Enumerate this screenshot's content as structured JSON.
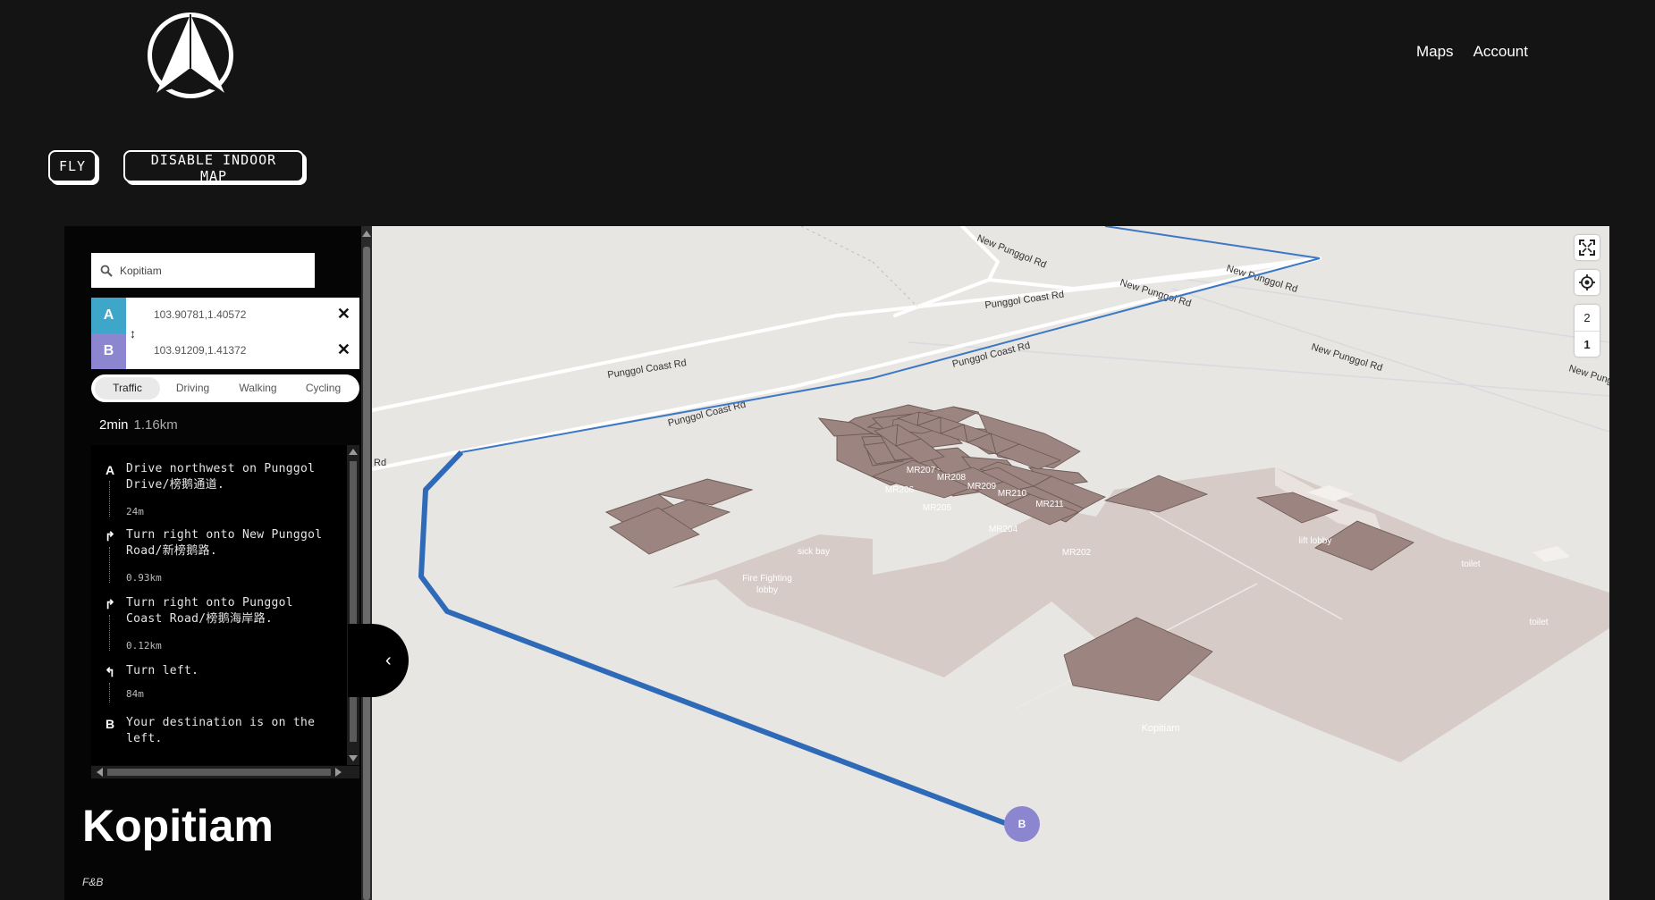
{
  "header": {
    "nav": [
      {
        "label": "Maps"
      },
      {
        "label": "Account"
      }
    ]
  },
  "toolbar": {
    "fly_label": "FLY",
    "indoor_label": "DISABLE INDOOR MAP"
  },
  "search": {
    "value": "Kopitiam"
  },
  "waypoints": {
    "a": {
      "badge": "A",
      "coords": "103.90781,1.40572"
    },
    "b": {
      "badge": "B",
      "coords": "103.91209,1.41372"
    },
    "remove": "✕",
    "swap": "↕"
  },
  "modes": [
    {
      "label": "Traffic",
      "active": true
    },
    {
      "label": "Driving",
      "active": false
    },
    {
      "label": "Walking",
      "active": false
    },
    {
      "label": "Cycling",
      "active": false
    }
  ],
  "route": {
    "duration": "2min",
    "distance": "1.16km"
  },
  "steps": [
    {
      "icon": "A",
      "text": "Drive northwest on Punggol Drive/榜鹅通道.",
      "length": "24m"
    },
    {
      "icon": "↱",
      "text": "Turn right onto New Punggol Road/新榜鹅路.",
      "length": "0.93km"
    },
    {
      "icon": "↱",
      "text": "Turn right onto Punggol Coast Road/榜鹅海岸路.",
      "length": "0.12km"
    },
    {
      "icon": "↰",
      "text": "Turn left.",
      "length": "84m"
    },
    {
      "icon": "B",
      "text": "Your destination is on the left.",
      "length": ""
    }
  ],
  "place": {
    "title": "Kopitiam",
    "category": "F&B"
  },
  "map": {
    "floors": [
      "2",
      "1"
    ],
    "active_floor": "1",
    "end_marker": "B",
    "roads": {
      "new_punggol_1": "New Punggol Rd",
      "new_punggol_2": "New Punggol Rd",
      "new_punggol_3": "New Punggol Rd",
      "new_punggol_4": "New Punggol Rd",
      "new_punggol_5": "New Pung",
      "coast_1": "Punggol Coast Rd",
      "coast_2": "Punggol Coast Rd",
      "coast_3": "Punggol Coast Rd",
      "coast_4": "Punggol Coast Rd",
      "rd_edge": "Rd"
    },
    "rooms": {
      "mr207": "MR207",
      "mr208": "MR208",
      "mr209": "MR209",
      "mr210": "MR210",
      "mr211": "MR211",
      "mr206": "MR206",
      "mr205": "MR205",
      "mr204": "MR204",
      "mr202": "MR202",
      "sickbay": "sick bay",
      "fire1": "Fire Fighting",
      "fire2": "lobby",
      "lift": "lift lobby",
      "toilet1": "toilet",
      "toilet2": "toilet",
      "kopitiam": "Kopitiam"
    },
    "colors": {
      "route": "#3d78c4",
      "room": "#9c8580",
      "floor": "#d6cbc6",
      "ground": "#e8e6e3"
    }
  }
}
